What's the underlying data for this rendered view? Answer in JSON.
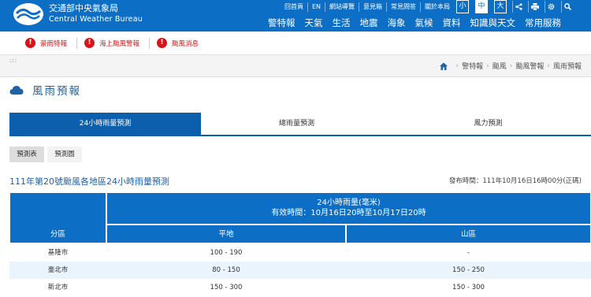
{
  "brand": {
    "zh": "交通部中央氣象局",
    "en": "Central Weather Bureau"
  },
  "toplinks": [
    "回首頁",
    "EN",
    "網站導覽",
    "意見箱",
    "常見問答",
    "關於本局"
  ],
  "fontsizes": [
    "小",
    "中",
    "大"
  ],
  "mainnav": [
    "警特報",
    "天氣",
    "生活",
    "地震",
    "海象",
    "氣候",
    "資料",
    "知識與天文",
    "常用服務"
  ],
  "alerts": [
    "豪雨特報",
    "海上颱風警報",
    "颱風消息"
  ],
  "accesskey": ":::",
  "breadcrumb": [
    "警特報",
    "颱風",
    "颱風警報",
    "風雨預報"
  ],
  "page_title": "風雨預報",
  "tabs": [
    "24小時雨量預測",
    "總雨量預測",
    "風力預測"
  ],
  "subtabs": [
    "預測表",
    "預測圖"
  ],
  "table_title": "111年第20號颱風各地區24小時雨量預測",
  "publish_time": "發布時間：111年10月16日16時00分(正碼)",
  "table": {
    "header_region": "分區",
    "header_main_1": "24小時雨量(毫米)",
    "header_main_2": "有效時間：10月16日20時至10月17日20時",
    "header_flat": "平地",
    "header_mountain": "山區",
    "rows": [
      {
        "region": "基隆市",
        "flat": "100 - 190",
        "mountain": "-"
      },
      {
        "region": "臺北市",
        "flat": "80 - 150",
        "mountain": "150 - 250"
      },
      {
        "region": "新北市",
        "flat": "150 - 300",
        "mountain": "150 - 300"
      }
    ]
  },
  "colors": {
    "primary": "#0c6fc5",
    "tab_active": "#0c5fad",
    "alert": "#d7141a",
    "row_alt": "#eaf4fd"
  }
}
